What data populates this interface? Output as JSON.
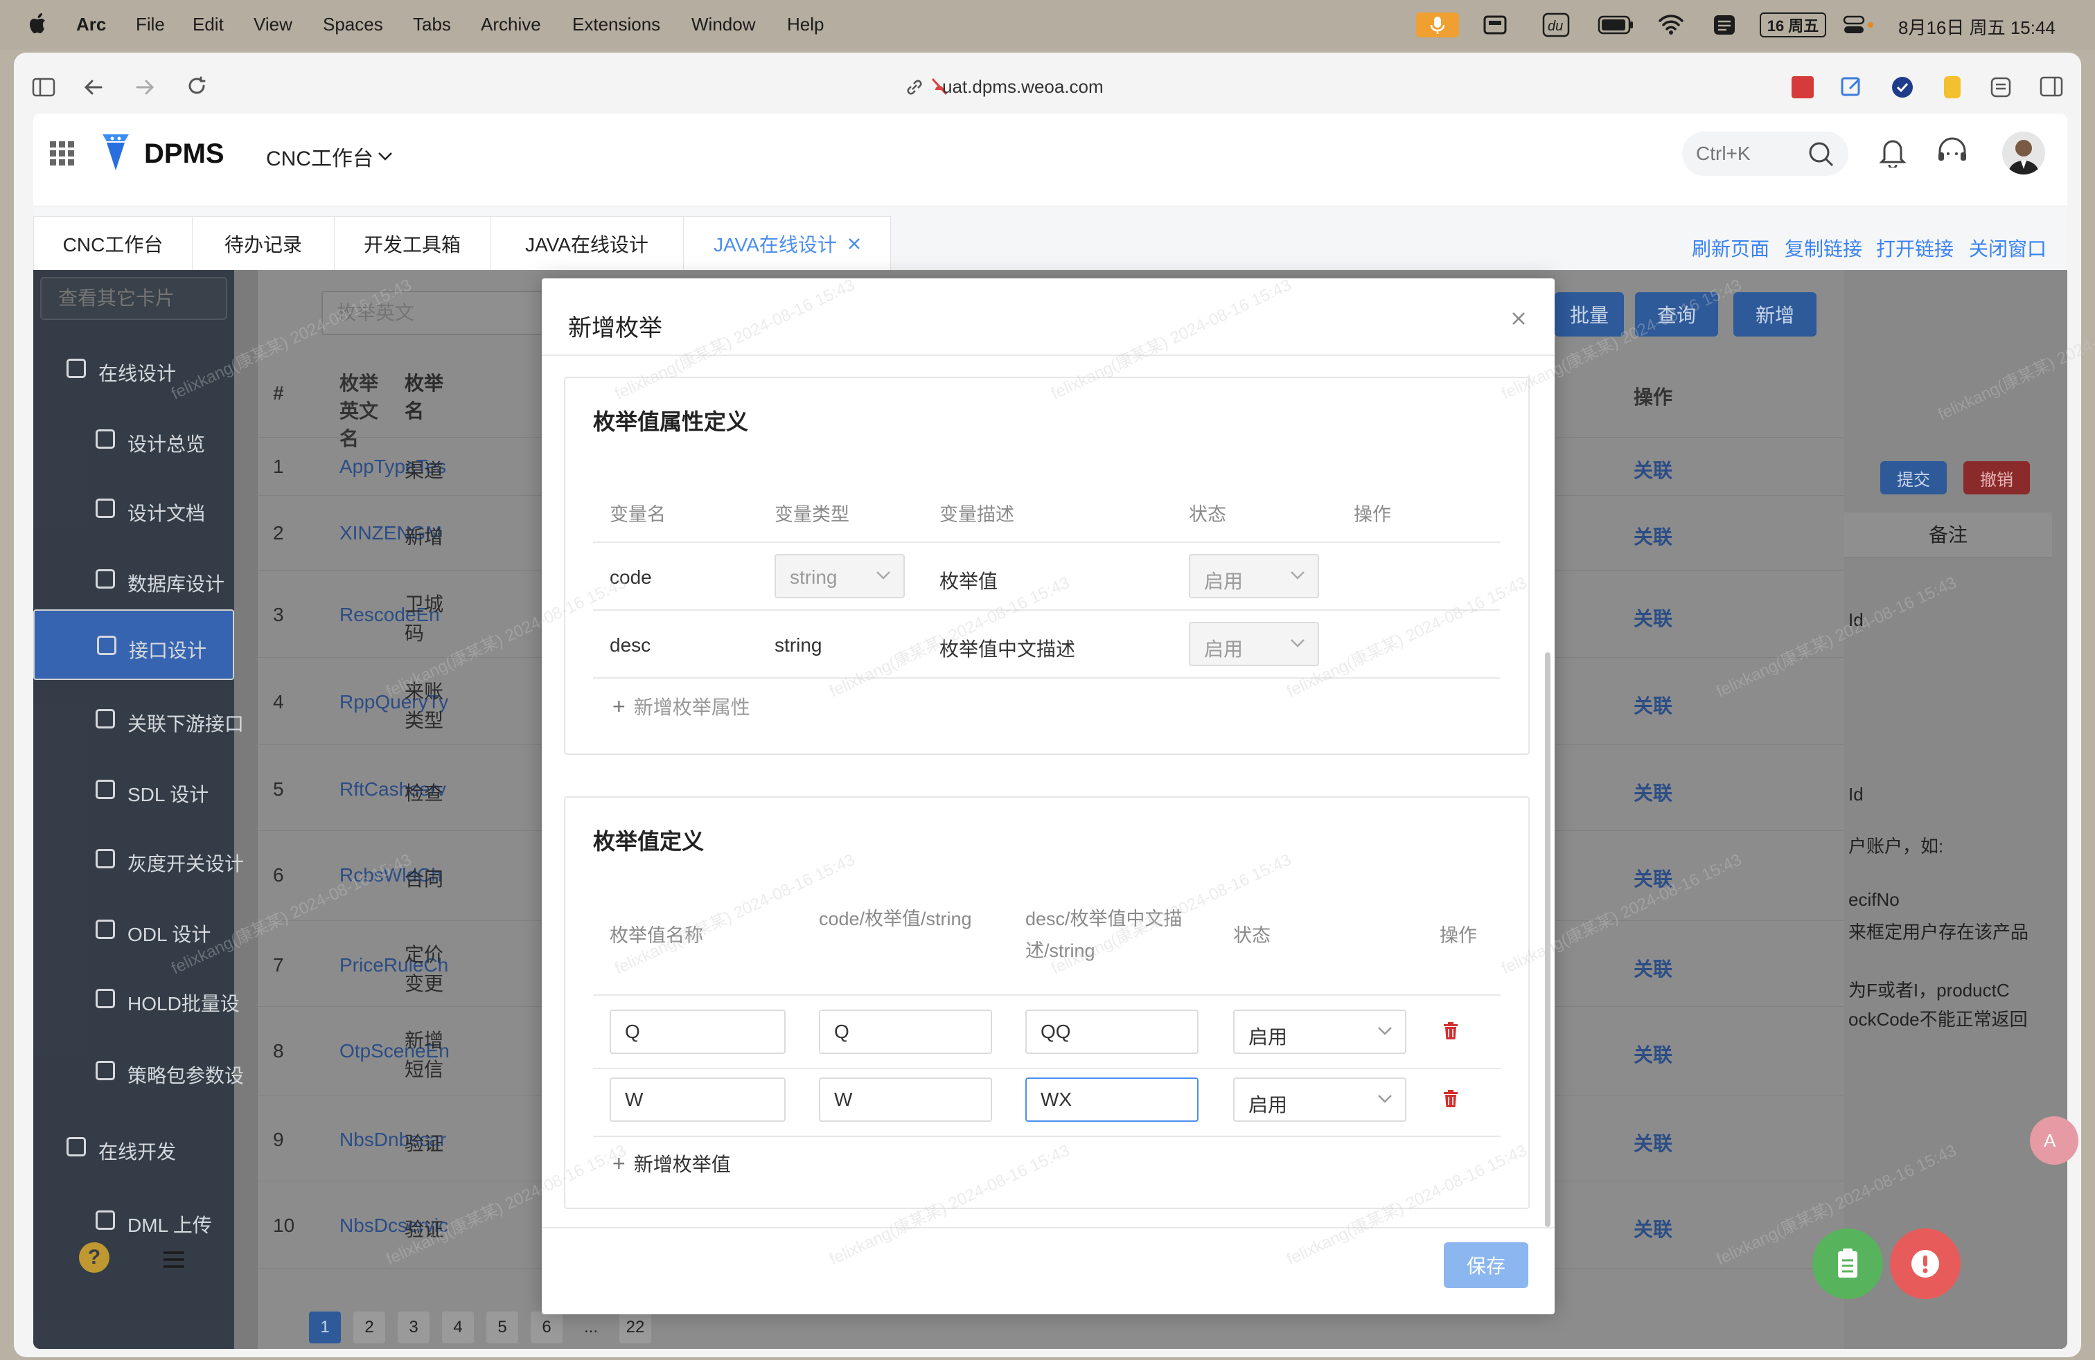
{
  "menubar": {
    "app": "Arc",
    "items": [
      "File",
      "Edit",
      "View",
      "Spaces",
      "Tabs",
      "Archive",
      "Extensions",
      "Window",
      "Help"
    ],
    "date_badge": "16 周五",
    "clock": "8月16日 周五 15:44"
  },
  "browser": {
    "url": "uat.dpms.weoa.com"
  },
  "app": {
    "logo": "DPMS",
    "workspace": "CNC工作台",
    "search_placeholder": "Ctrl+K"
  },
  "tabs": [
    {
      "label": "CNC工作台"
    },
    {
      "label": "待办记录"
    },
    {
      "label": "开发工具箱"
    },
    {
      "label": "JAVA在线设计"
    },
    {
      "label": "JAVA在线设计"
    }
  ],
  "tab_actions": [
    "刷新页面",
    "复制链接",
    "打开链接",
    "关闭窗口"
  ],
  "sidebar": {
    "search_placeholder": "查看其它卡片",
    "items": [
      {
        "label": "在线设计",
        "group": true
      },
      {
        "label": "设计总览"
      },
      {
        "label": "设计文档"
      },
      {
        "label": "数据库设计"
      },
      {
        "label": "接口设计",
        "selected": true
      },
      {
        "label": "关联下游接口"
      },
      {
        "label": "SDL 设计"
      },
      {
        "label": "灰度开关设计"
      },
      {
        "label": "ODL 设计"
      },
      {
        "label": "HOLD批量设"
      },
      {
        "label": "策略包参数设"
      },
      {
        "label": "在线开发",
        "group": true
      },
      {
        "label": "DML 上传"
      }
    ]
  },
  "main": {
    "filter_placeholder": "枚举英文",
    "buttons": [
      "批量",
      "查询",
      "新增"
    ],
    "columns": [
      "#",
      "枚举英文名",
      "枚举名",
      "操作"
    ],
    "rows": [
      {
        "n": "1",
        "en": "AppTypeTes",
        "cn": "渠道",
        "op": "关联"
      },
      {
        "n": "2",
        "en": "XINZENGM",
        "cn": "新增",
        "op": "关联"
      },
      {
        "n": "3",
        "en": "RescodeEn",
        "cn": "卫城码",
        "op": "关联"
      },
      {
        "n": "4",
        "en": "RppQueryTy",
        "cn": "来账类型",
        "op": "关联"
      },
      {
        "n": "5",
        "en": "RftCashserv",
        "cn": "检查",
        "op": "关联"
      },
      {
        "n": "6",
        "en": "RcbsWldCh",
        "cn": "合同",
        "op": "关联"
      },
      {
        "n": "7",
        "en": "PriceRuleCh",
        "cn": "定价变更",
        "op": "关联"
      },
      {
        "n": "8",
        "en": "OtpSceneEn",
        "cn": "新增短信",
        "op": "关联"
      },
      {
        "n": "9",
        "en": "NbsDnbscar",
        "cn": "验证",
        "op": "关联"
      },
      {
        "n": "10",
        "en": "NbsDcservic",
        "cn": "验证",
        "op": "关联"
      }
    ],
    "pagination": [
      "1",
      "2",
      "3",
      "4",
      "5",
      "6",
      "...",
      "22"
    ]
  },
  "right_panel": {
    "buttons": [
      "提交",
      "撤销"
    ],
    "header": "备注",
    "lines": [
      "Id",
      "Id",
      "户账户，如:",
      "ecifNo",
      "来框定用户存在该产品",
      "为F或者I，productC",
      "ockCode不能正常返回"
    ]
  },
  "modal": {
    "title": "新增枚举",
    "attr_section": {
      "title": "枚举值属性定义",
      "headers": [
        "变量名",
        "变量类型",
        "变量描述",
        "状态",
        "操作"
      ],
      "rows": [
        {
          "name": "code",
          "type": "string",
          "desc": "枚举值",
          "status": "启用"
        },
        {
          "name": "desc",
          "type": "string",
          "desc": "枚举值中文描述",
          "status": "启用"
        }
      ],
      "add_label": "新增枚举属性"
    },
    "value_section": {
      "title": "枚举值定义",
      "headers": [
        "枚举值名称",
        "code/枚举值/string",
        "desc/枚举值中文描述/string",
        "状态",
        "操作"
      ],
      "rows": [
        {
          "name": "Q",
          "code": "Q",
          "desc": "QQ",
          "status": "启用"
        },
        {
          "name": "W",
          "code": "W",
          "desc": "WX",
          "status": "启用"
        }
      ],
      "add_label": "新增枚举值"
    },
    "save_label": "保存"
  },
  "watermark": "felixkang(康某某) 2024-08-16 15:43",
  "colors": {
    "primary": "#4c8ef0",
    "sidebar": "#2d3742",
    "selected": "#2f62b6",
    "danger": "#d32f2f",
    "fab_green": "#57b35c",
    "fab_red": "#e85b5b"
  },
  "icons": [
    "apple-icon",
    "mic-icon",
    "wifi-icon",
    "battery-icon",
    "grid-icon",
    "search-icon",
    "bell-icon",
    "headset-icon",
    "close-icon",
    "chevron-down-icon",
    "plus-icon",
    "trash-icon",
    "clipboard-icon",
    "alert-icon",
    "translate-icon"
  ]
}
